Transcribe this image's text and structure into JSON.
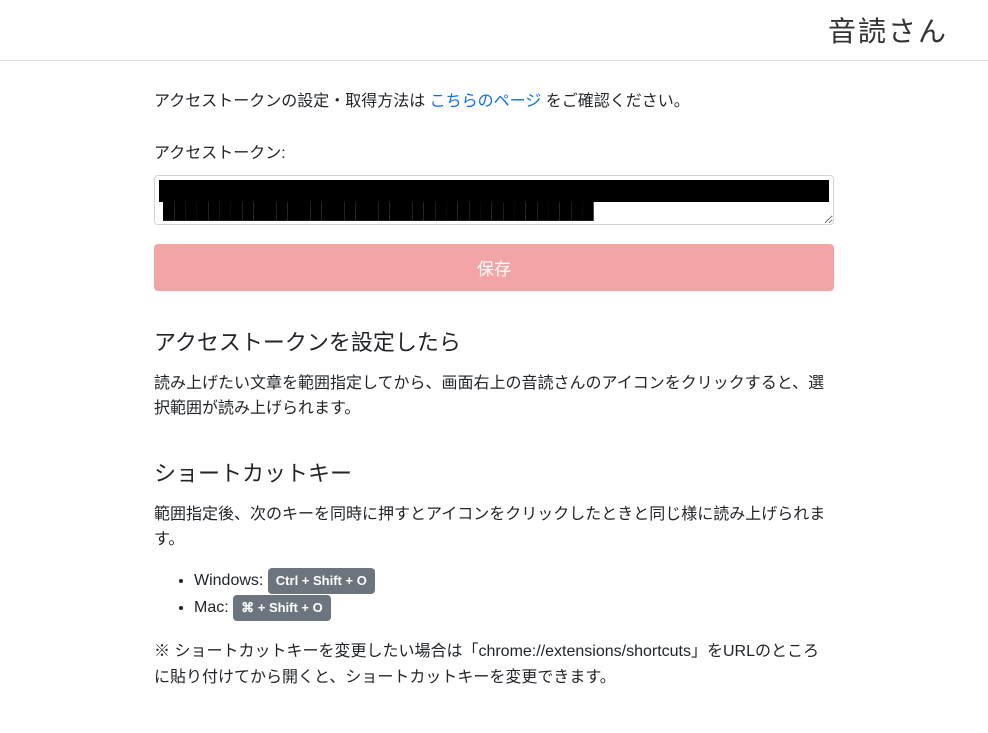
{
  "header": {
    "title": "音読さん"
  },
  "intro": {
    "prefix": "アクセストークンの設定・取得方法は ",
    "link_text": "こちらのページ",
    "suffix": " をご確認ください。"
  },
  "form": {
    "label": "アクセストークン:",
    "token_value": "████████████████████████████████████████████████████████████████████████████████████████████████",
    "save_label": "保存"
  },
  "section_after": {
    "heading": "アクセストークンを設定したら",
    "body": "読み上げたい文章を範囲指定してから、画面右上の音読さんのアイコンをクリックすると、選択範囲が読み上げられます。"
  },
  "section_shortcut": {
    "heading": "ショートカットキー",
    "body": "範囲指定後、次のキーを同時に押すとアイコンをクリックしたときと同じ様に読み上げられます。",
    "items": [
      {
        "os": "Windows: ",
        "keys": "Ctrl + Shift + O"
      },
      {
        "os": "Mac: ",
        "keys": "⌘ + Shift + O"
      }
    ],
    "note": "※ ショートカットキーを変更したい場合は「chrome://extensions/shortcuts」をURLのところに貼り付けてから開くと、ショートカットキーを変更できます。"
  }
}
